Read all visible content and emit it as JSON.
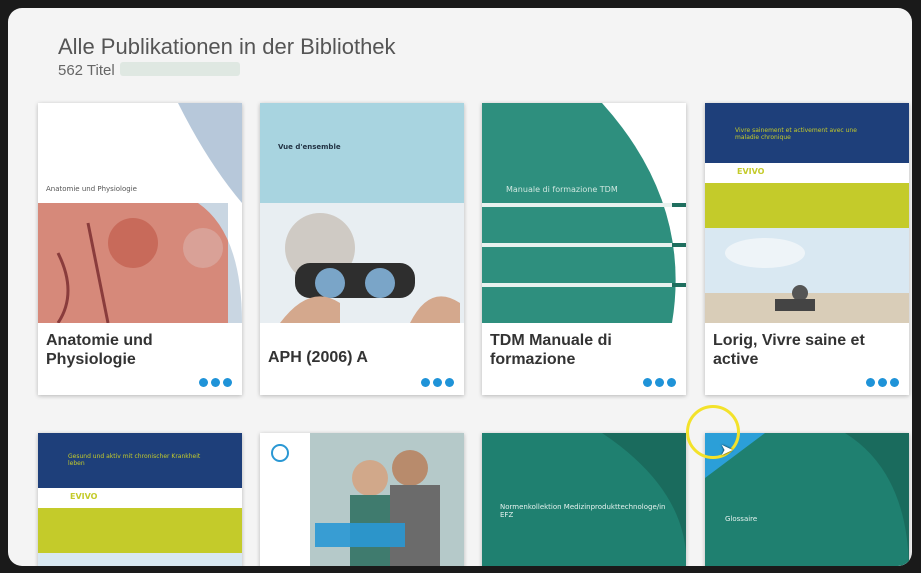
{
  "header": {
    "title": "Alle Publikationen in der Bibliothek",
    "count": "562 Titel"
  },
  "cards_row1": [
    {
      "title": "Anatomie und Physiologie",
      "cover_small": "Anatomie und Physiologie"
    },
    {
      "title": "APH (2006) A",
      "cover_small": "Vue d'ensemble"
    },
    {
      "title": "TDM Manuale di formazione",
      "cover_small": "Manuale di formazione TDM"
    },
    {
      "title": "Lorig, Vivre saine et active",
      "cover_small": "Vivre sainement et activement avec une maladie chronique",
      "brand": "EVIVO"
    }
  ],
  "cards_row2": [
    {
      "cover_small": "Gesund und aktiv mit chronischer Krankheit leben",
      "brand": "EVIVO"
    },
    {
      "cover_small": ""
    },
    {
      "cover_small": "Normenkollektion Medizinprodukttechnologe/in EFZ"
    },
    {
      "cover_small": "Glossaire"
    }
  ],
  "colors": {
    "accent": "#1f93d8",
    "teal": "#2e8f7e",
    "navy": "#1e3f7a",
    "lime": "#c4cb2a",
    "cursor_ring": "#f3e22a"
  }
}
